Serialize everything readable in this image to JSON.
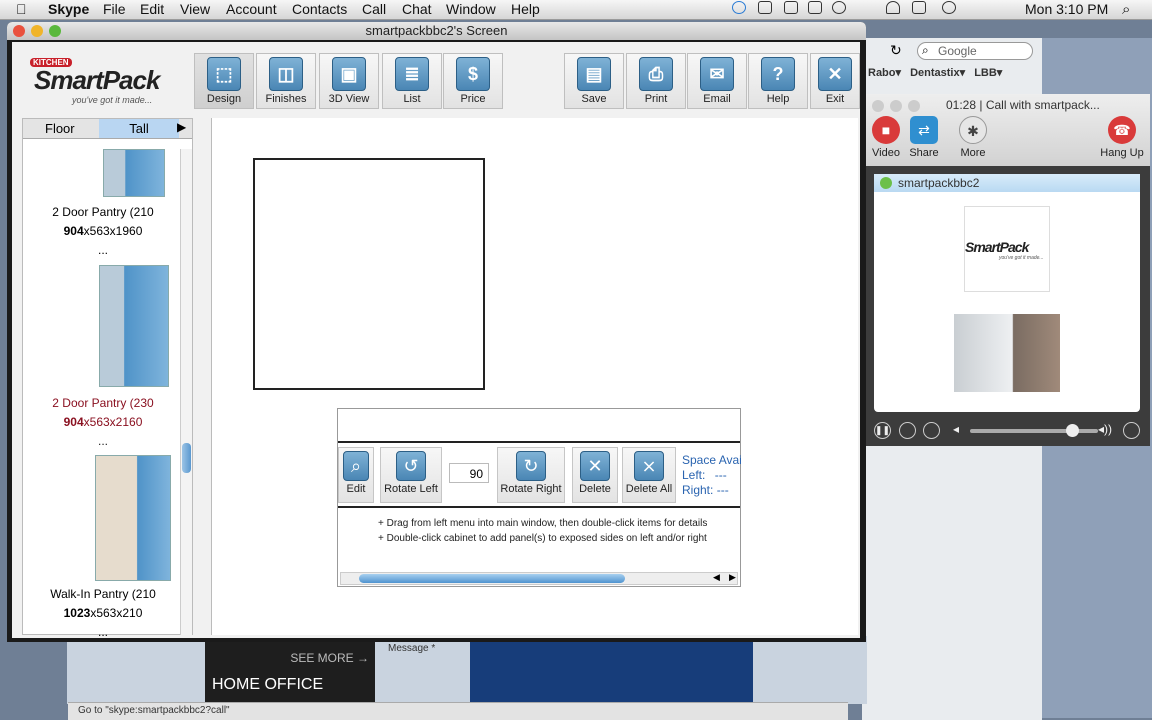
{
  "menubar": {
    "app": "Skype",
    "items": [
      "File",
      "Edit",
      "View",
      "Account",
      "Contacts",
      "Call",
      "Chat",
      "Window",
      "Help"
    ],
    "clock": "Mon 3:10 PM"
  },
  "browser": {
    "search_placeholder": "Google",
    "bookmarks": [
      "Rabo▾",
      "Dentastix▾",
      "LBB▾"
    ],
    "see_more": "SEE MORE →",
    "home_office": "HOME OFFICE",
    "message_label": "Message *",
    "status_text": "Go to \"skype:smartpackbbc2?call\""
  },
  "window": {
    "title": "smartpackbbc2's Screen"
  },
  "logo": {
    "kitchen": "KITCHEN",
    "name": "SmartPack",
    "tagline": "you've got it made..."
  },
  "toolbar": {
    "design": "Design",
    "finishes": "Finishes",
    "view3d": "3D View",
    "list": "List",
    "price": "Price",
    "save": "Save",
    "print": "Print",
    "email": "Email",
    "help": "Help",
    "exit": "Exit"
  },
  "sidebar": {
    "tab_floor": "Floor",
    "tab_tall": "Tall",
    "items": [
      {
        "name": "2 Door Pantry (210",
        "dims_bold": "904",
        "dims": "x563x1960",
        "more": "..."
      },
      {
        "name": "2 Door Pantry (230",
        "dims_bold": "904",
        "dims": "x563x2160",
        "more": "..."
      },
      {
        "name": "Walk-In Pantry (210",
        "dims_bold": "1023",
        "dims": "x563x210",
        "more": "..."
      }
    ]
  },
  "panel": {
    "edit": "Edit",
    "rotate_left": "Rotate Left",
    "angle": "90",
    "rotate_right": "Rotate Right",
    "delete": "Delete",
    "delete_all": "Delete All",
    "space_title": "Space Avai",
    "left_label": "Left:",
    "left_value": "---",
    "right_label": "Right:",
    "right_value": "---",
    "hint1": "+ Drag from left menu into main window, then double-click items for details",
    "hint2": "+ Double-click cabinet to add panel(s) to exposed sides on left and/or right"
  },
  "skype": {
    "call_title": "01:28 | Call with smartpack...",
    "video": "Video",
    "share": "Share",
    "more": "More",
    "hang_up": "Hang Up",
    "contact": "smartpackbbc2"
  },
  "colors": {
    "accent": "#4a86b4",
    "hangup": "#d93a3a",
    "video": "#d93a3a",
    "share": "#2f8fd0"
  }
}
